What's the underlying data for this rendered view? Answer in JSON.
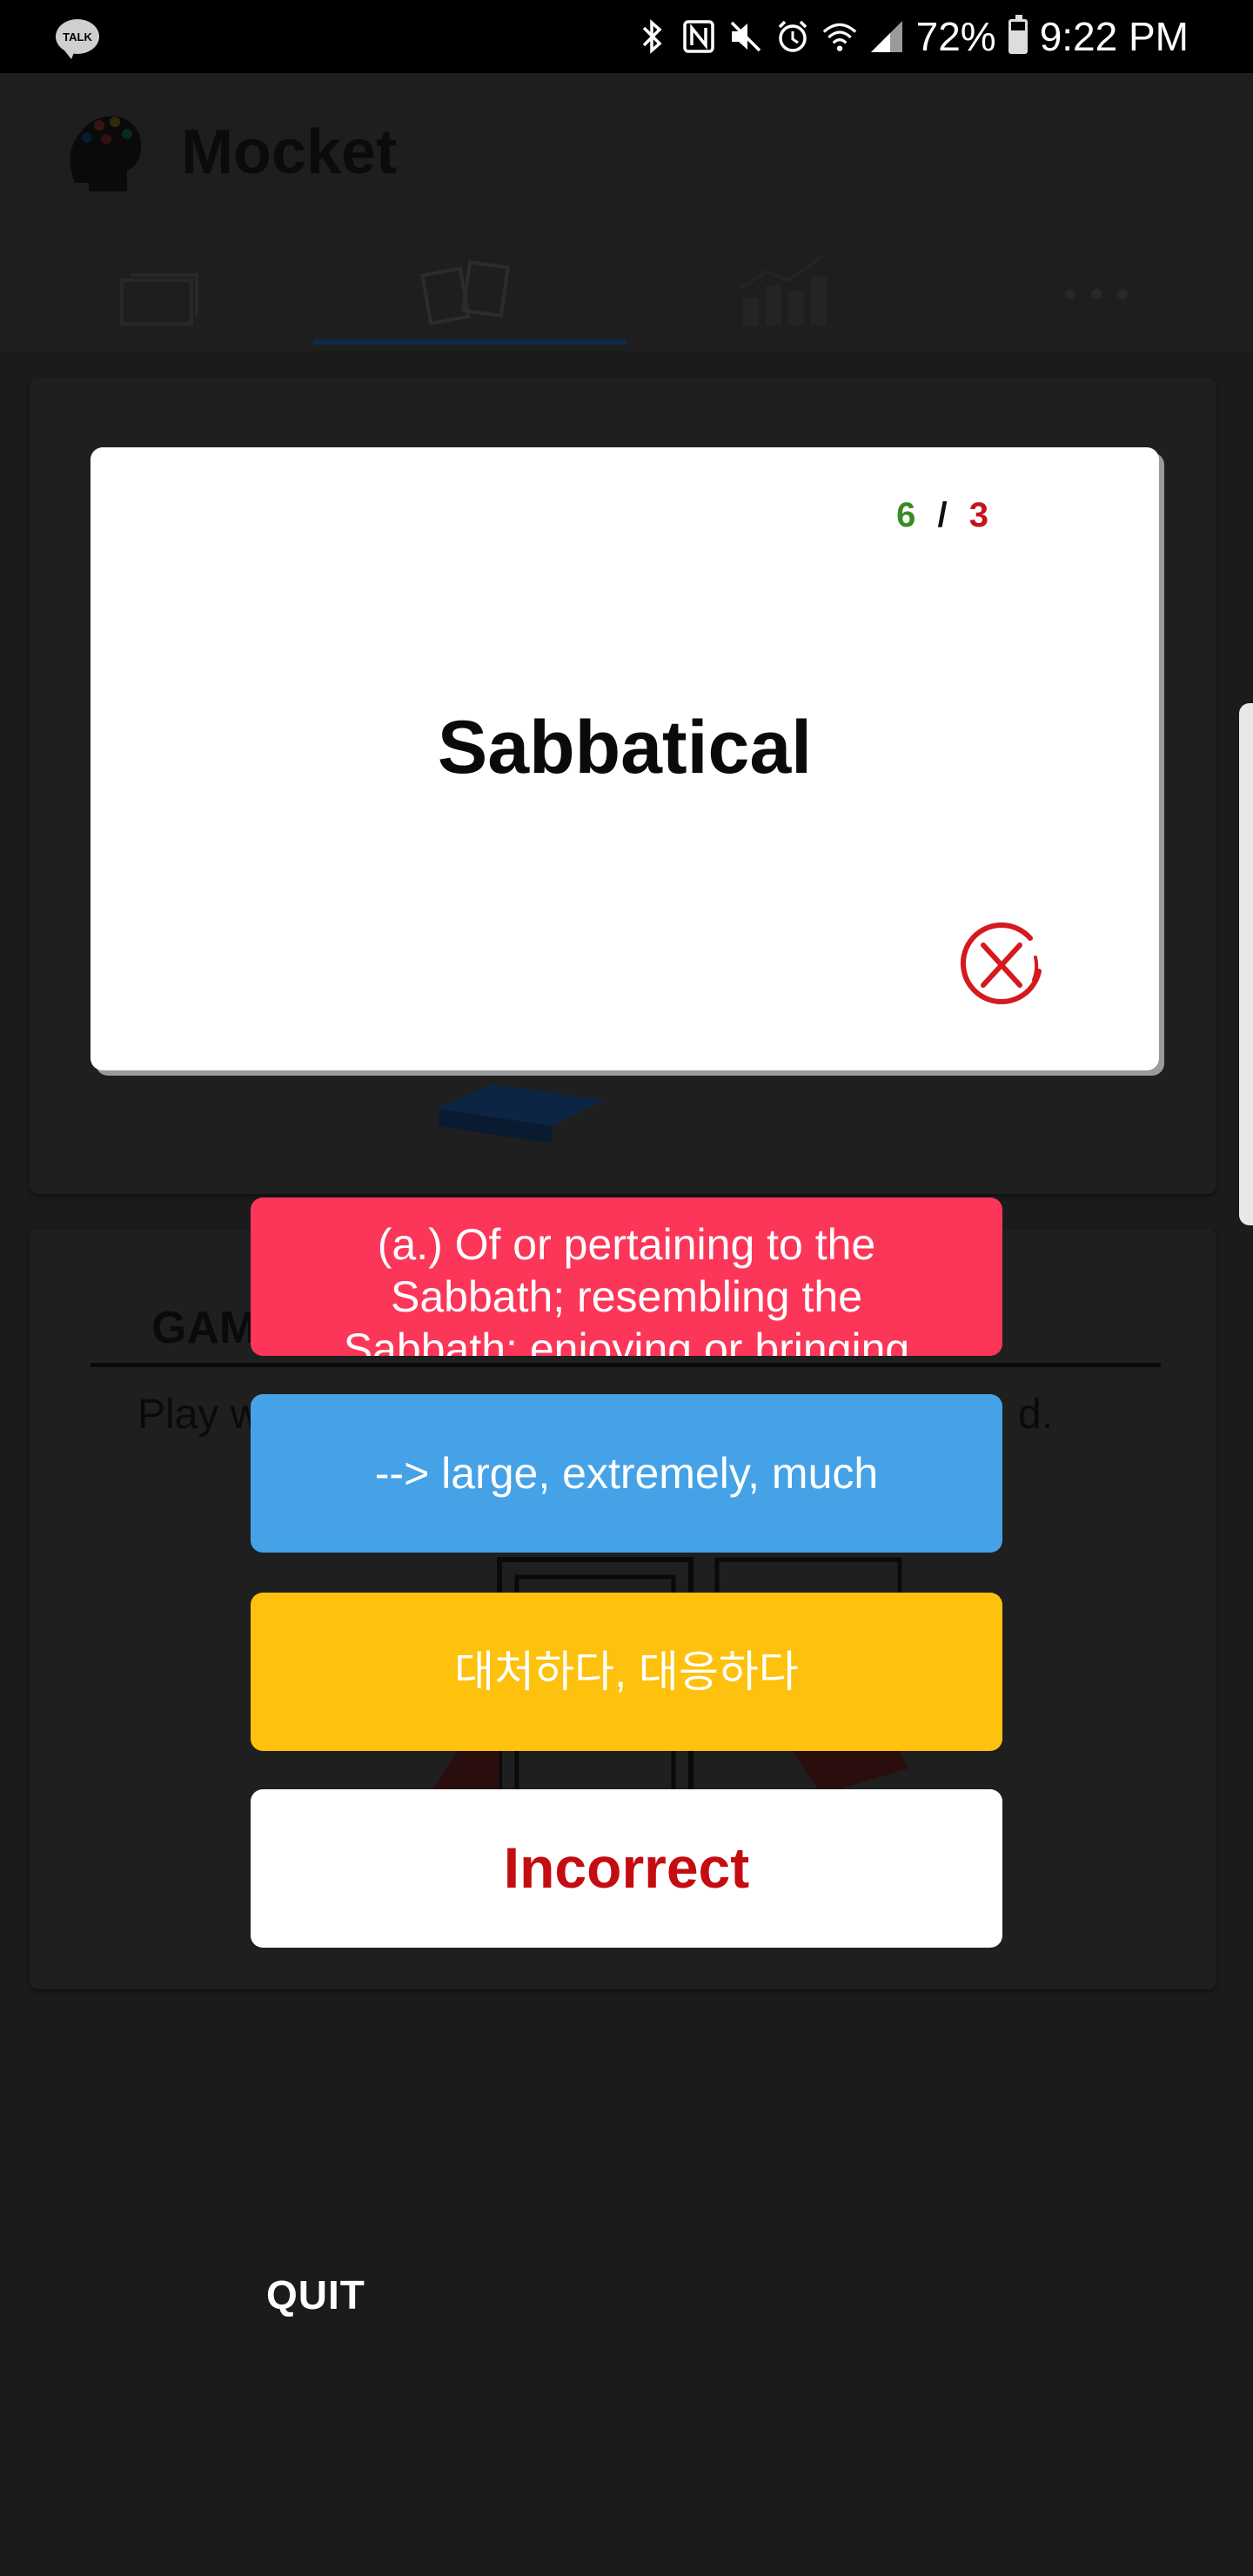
{
  "statusbar": {
    "talk_label": "TALK",
    "battery": "72%",
    "time": "9:22 PM"
  },
  "app": {
    "title": "Mocket"
  },
  "background": {
    "games_heading": "GAM",
    "games_sub_start": "Play w",
    "games_sub_end": "d."
  },
  "card": {
    "word": "Sabbatical",
    "correct_count": "6",
    "separator": "/",
    "wrong_count": "3"
  },
  "options": [
    {
      "label": "(a.) Of or pertaining to the Sabbath; resembling the Sabbath; enjoying or bringing"
    },
    {
      "label": "--> large, extremely, much"
    },
    {
      "label": "대처하다, 대응하다"
    }
  ],
  "result": {
    "label": "Incorrect"
  },
  "quit_label": "QUIT",
  "colors": {
    "option_red": "#fb3659",
    "option_blue": "#45a2e7",
    "option_yellow": "#fdc10e",
    "incorrect": "#c40d10",
    "score_correct": "#3a8b23",
    "score_wrong": "#c2151c"
  }
}
